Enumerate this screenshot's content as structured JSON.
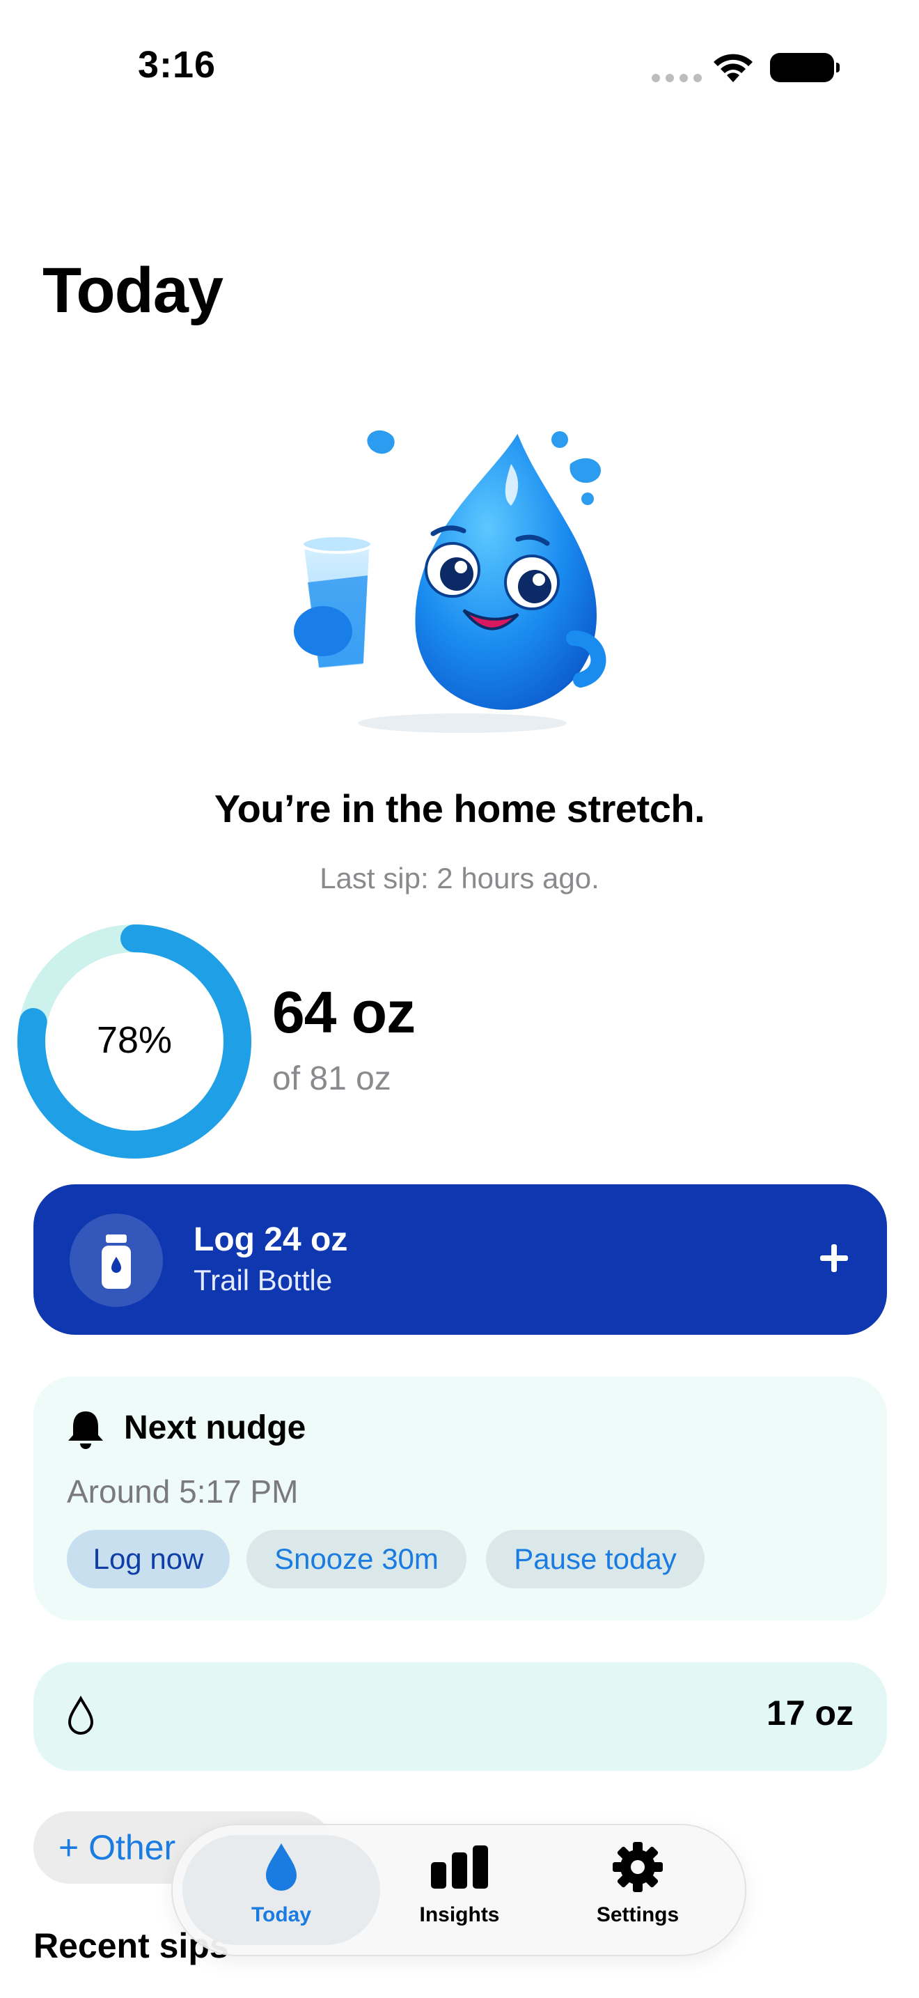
{
  "status_bar": {
    "time": "3:16"
  },
  "page_title": "Today",
  "headline": "You’re in the home stretch.",
  "last_sip": "Last sip: 2 hours ago.",
  "progress": {
    "percent_label": "78%",
    "fraction": 0.78,
    "amount": "64 oz",
    "goal": "of 81 oz"
  },
  "log_button": {
    "title": "Log 24 oz",
    "subtitle": "Trail Bottle",
    "icon": "bottle-icon",
    "action_icon": "plus-icon"
  },
  "nudge": {
    "title": "Next nudge",
    "time": "Around 5:17 PM",
    "actions": [
      "Log now",
      "Snooze 30m",
      "Pause today"
    ]
  },
  "intake_row": {
    "icon": "water-drop-icon",
    "value": "17 oz"
  },
  "other_chip": "+ Other",
  "recent_title": "Recent sips",
  "tabs": [
    {
      "label": "Today",
      "icon": "water-drop-icon",
      "active": true
    },
    {
      "label": "Insights",
      "icon": "bar-chart-icon",
      "active": false
    },
    {
      "label": "Settings",
      "icon": "gear-icon",
      "active": false
    }
  ],
  "colors": {
    "accent_blue": "#1a7be0",
    "log_button_bg": "#0e37b0",
    "ring_progress": "#1f9fe6",
    "ring_track": "#cdf2ee",
    "nudge_card_bg": "#eefbf8",
    "intake_card_bg": "#e3f7f4"
  }
}
